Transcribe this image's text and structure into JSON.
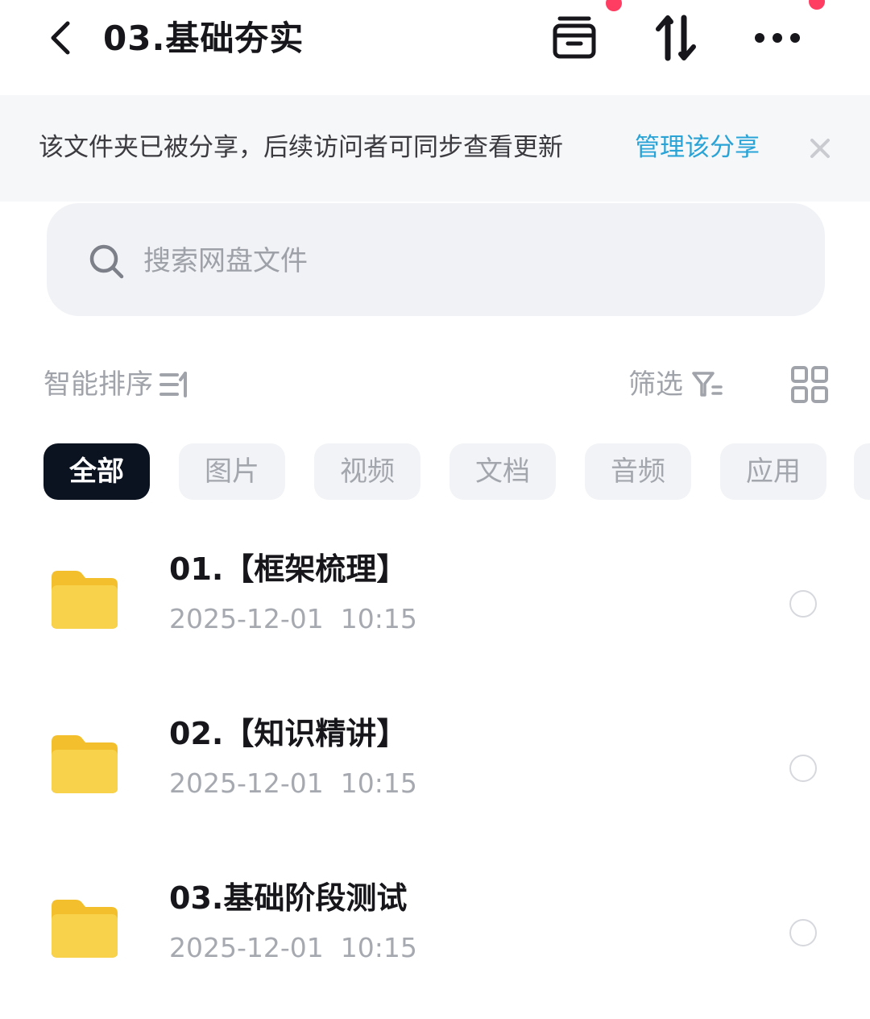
{
  "header": {
    "title": "03.基础夯实",
    "back_icon": "chevron-left-icon",
    "actions": [
      {
        "icon": "archive-box-icon",
        "has_badge": true
      },
      {
        "icon": "sort-arrows-icon",
        "has_badge": false
      },
      {
        "icon": "more-dots-icon",
        "has_badge": true
      }
    ]
  },
  "share_banner": {
    "message": "该文件夹已被分享，后续访问者可同步查看更新",
    "action_label": "管理该分享",
    "close_icon": "close-icon"
  },
  "search": {
    "placeholder": "搜索网盘文件",
    "value": ""
  },
  "toolbar": {
    "sort_label": "智能排序",
    "sort_icon": "sort-list-icon",
    "filter_label": "筛选",
    "filter_icon": "filter-icon",
    "view_icon": "grid-view-icon"
  },
  "categories": [
    {
      "label": "全部",
      "active": true
    },
    {
      "label": "图片",
      "active": false
    },
    {
      "label": "视频",
      "active": false
    },
    {
      "label": "文档",
      "active": false
    },
    {
      "label": "音频",
      "active": false
    },
    {
      "label": "应用",
      "active": false
    }
  ],
  "files": [
    {
      "name": "01.【框架梳理】",
      "date": "2025-12-01  10:15",
      "type": "folder",
      "selected": false
    },
    {
      "name": "02.【知识精讲】",
      "date": "2025-12-01  10:15",
      "type": "folder",
      "selected": false
    },
    {
      "name": "03.基础阶段测试",
      "date": "2025-12-01  10:15",
      "type": "folder",
      "selected": false
    }
  ],
  "colors": {
    "accent_link": "#2aa3d6",
    "active_chip": "#0b1220",
    "badge": "#ff3d63",
    "folder": "#f8cf3e"
  }
}
